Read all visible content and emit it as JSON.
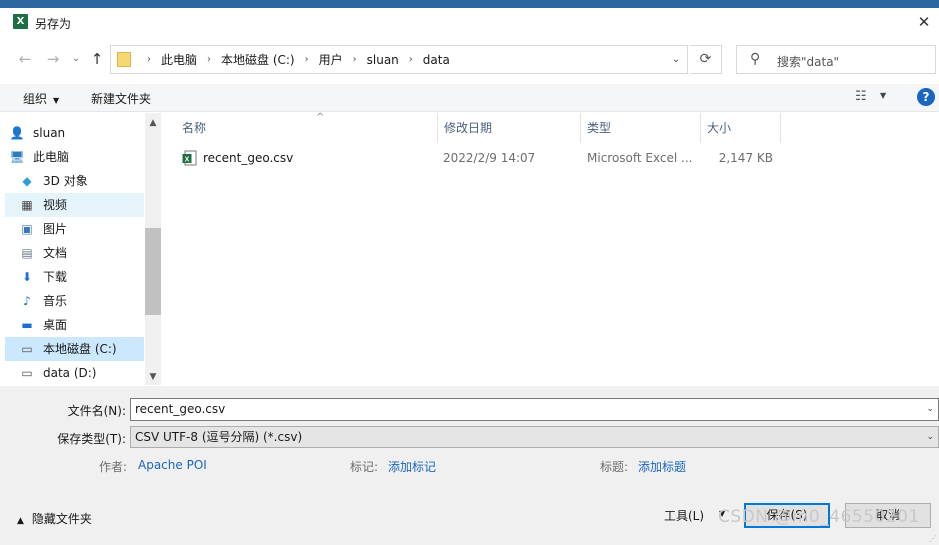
{
  "window": {
    "title": "另存为",
    "app_icon_letter": "X",
    "close_glyph": "✕"
  },
  "nav": {
    "back": "←",
    "forward": "→",
    "dropdown": "⌄",
    "up": "↑"
  },
  "address": {
    "crumbs": [
      "此电脑",
      "本地磁盘 (C:)",
      "用户",
      "sluan",
      "data"
    ],
    "separator": "›",
    "dropdown": "⌄",
    "refresh": "⟳"
  },
  "search": {
    "icon": "⚲",
    "placeholder": "搜索\"data\""
  },
  "toolbar": {
    "organize": "组织",
    "new_folder": "新建文件夹",
    "caret": "▼",
    "view_icon": "☷",
    "help": "?"
  },
  "sidebar": {
    "items": [
      {
        "label": "sluan",
        "icon": "user-icon",
        "glyph": "👤",
        "color": "#5b8a4a"
      },
      {
        "label": "此电脑",
        "icon": "computer-icon",
        "glyph": "🖥",
        "color": "#2a7bc7"
      },
      {
        "label": "3D 对象",
        "icon": "cube-icon",
        "glyph": "◆",
        "color": "#2aa0d8"
      },
      {
        "label": "视频",
        "icon": "video-icon",
        "glyph": "▦",
        "color": "#444444"
      },
      {
        "label": "图片",
        "icon": "pictures-icon",
        "glyph": "▣",
        "color": "#3a78b8"
      },
      {
        "label": "文档",
        "icon": "documents-icon",
        "glyph": "▤",
        "color": "#6a7a8a"
      },
      {
        "label": "下载",
        "icon": "download-icon",
        "glyph": "⬇",
        "color": "#1a6fd1"
      },
      {
        "label": "音乐",
        "icon": "music-icon",
        "glyph": "♪",
        "color": "#1a6fd1"
      },
      {
        "label": "桌面",
        "icon": "desktop-icon",
        "glyph": "▬",
        "color": "#1a6fd1"
      },
      {
        "label": "本地磁盘 (C:)",
        "icon": "drive-icon",
        "glyph": "▭",
        "color": "#555555"
      },
      {
        "label": "data (D:)",
        "icon": "drive-icon",
        "glyph": "▭",
        "color": "#555555"
      }
    ],
    "scroll_up": "▲",
    "scroll_down": "▼"
  },
  "columns": {
    "name": "名称",
    "modified": "修改日期",
    "type": "类型",
    "size": "大小",
    "sort": "^"
  },
  "files": [
    {
      "name": "recent_geo.csv",
      "modified": "2022/2/9 14:07",
      "type": "Microsoft Excel ...",
      "size": "2,147 KB"
    }
  ],
  "form": {
    "filename_label": "文件名(N):",
    "filename_value": "recent_geo.csv",
    "filetype_label": "保存类型(T):",
    "filetype_value": "CSV UTF-8 (逗号分隔) (*.csv)",
    "dd_arrow": "⌄",
    "author_label": "作者:",
    "author_value": "Apache POI",
    "tags_label": "标记:",
    "tags_value": "添加标记",
    "title_label": "标题:",
    "title_value": "添加标题"
  },
  "footer": {
    "hide_folders": "隐藏文件夹",
    "hide_chevron": "▲",
    "tools": "工具(L)",
    "tools_caret": "▼",
    "save": "保存(S)",
    "cancel": "取消"
  },
  "watermark": "CSDN @m0_46550201",
  "colors": {
    "accent": "#0078d7",
    "selected": "#cce8ff",
    "hover": "#e5f3fb",
    "link": "#1a67c0",
    "excel": "#1d6f42"
  }
}
